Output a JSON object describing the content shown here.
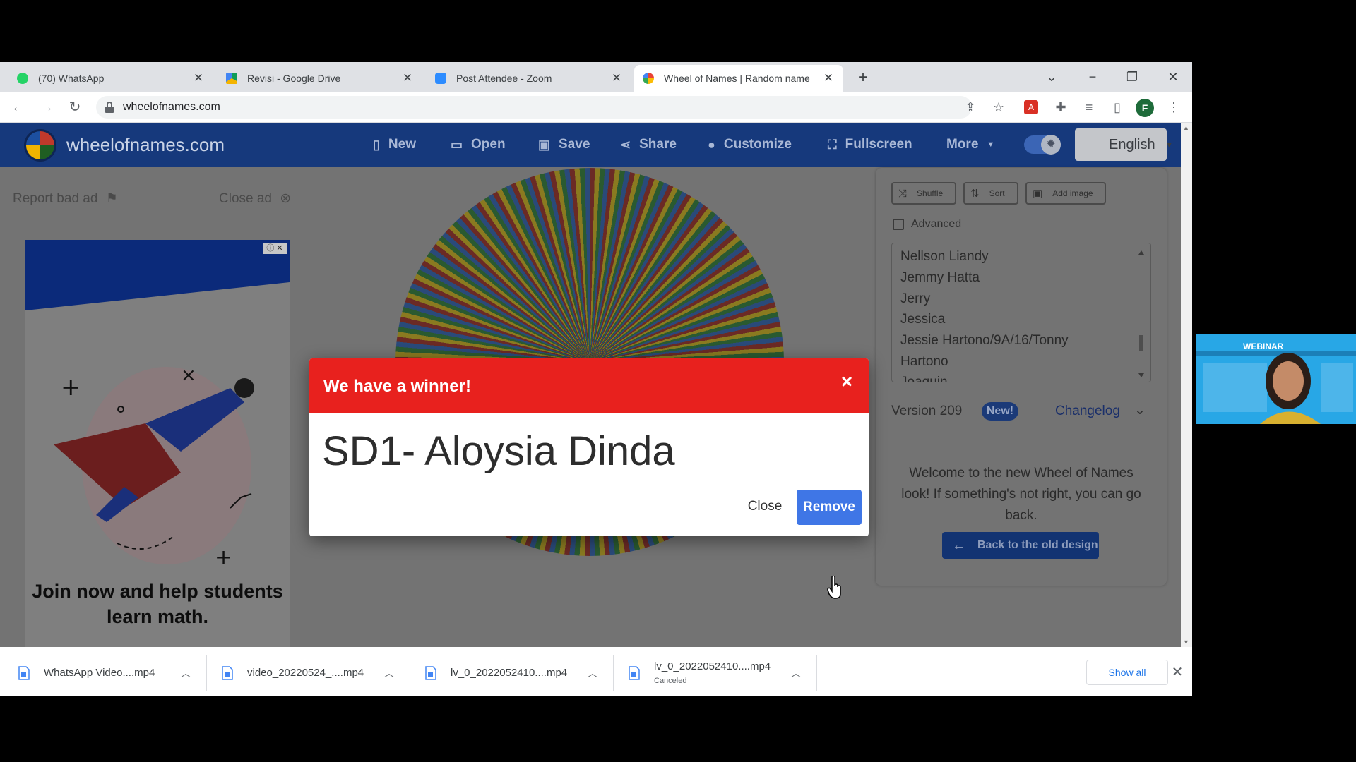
{
  "browser": {
    "tabs": [
      {
        "title": "(70) WhatsApp",
        "favicon_color": "#25d366"
      },
      {
        "title": "Revisi - Google Drive",
        "favicon_color": "#f4b400"
      },
      {
        "title": "Post Attendee - Zoom",
        "favicon_color": "#2d8cff"
      },
      {
        "title": "Wheel of Names | Random name",
        "favicon_color": "#ea4335"
      }
    ],
    "url": "wheelofnames.com",
    "profile_initial": "F"
  },
  "site": {
    "name": "wheelofnames.com",
    "nav": {
      "new": "New",
      "open": "Open",
      "save": "Save",
      "share": "Share",
      "customize": "Customize",
      "fullscreen": "Fullscreen",
      "more": "More"
    },
    "language": "English",
    "ad": {
      "report": "Report bad ad",
      "close": "Close ad",
      "headline": "Join now and help students learn math."
    },
    "panel": {
      "shuffle": "Shuffle",
      "sort": "Sort",
      "add_image": "Add image",
      "advanced": "Advanced",
      "names": [
        "Nellson Liandy",
        "Jemmy Hatta",
        "Jerry",
        "Jessica",
        "Jessie Hartono/9A/16/Tonny",
        "Hartono",
        "Joaquin"
      ],
      "version": "Version 209",
      "new_badge": "New!",
      "changelog": "Changelog",
      "welcome": "Welcome to the new Wheel of Names look! If something's not right, you can go back.",
      "back_button": "Back to the old design"
    },
    "modal": {
      "title": "We have a winner!",
      "winner": "SD1- Aloysia Dinda",
      "close": "Close",
      "remove": "Remove"
    }
  },
  "downloads": {
    "items": [
      {
        "name": "WhatsApp Video....mp4",
        "status": ""
      },
      {
        "name": "video_20220524_....mp4",
        "status": ""
      },
      {
        "name": "lv_0_2022052410....mp4",
        "status": ""
      },
      {
        "name": "lv_0_2022052410....mp4",
        "status": "Canceled"
      }
    ],
    "show_all": "Show all"
  },
  "webcam": {
    "banner": "WEBINAR"
  },
  "colors": {
    "navbar": "#16397c",
    "modal_header": "#e8211e",
    "remove_button": "#3f76e6"
  }
}
